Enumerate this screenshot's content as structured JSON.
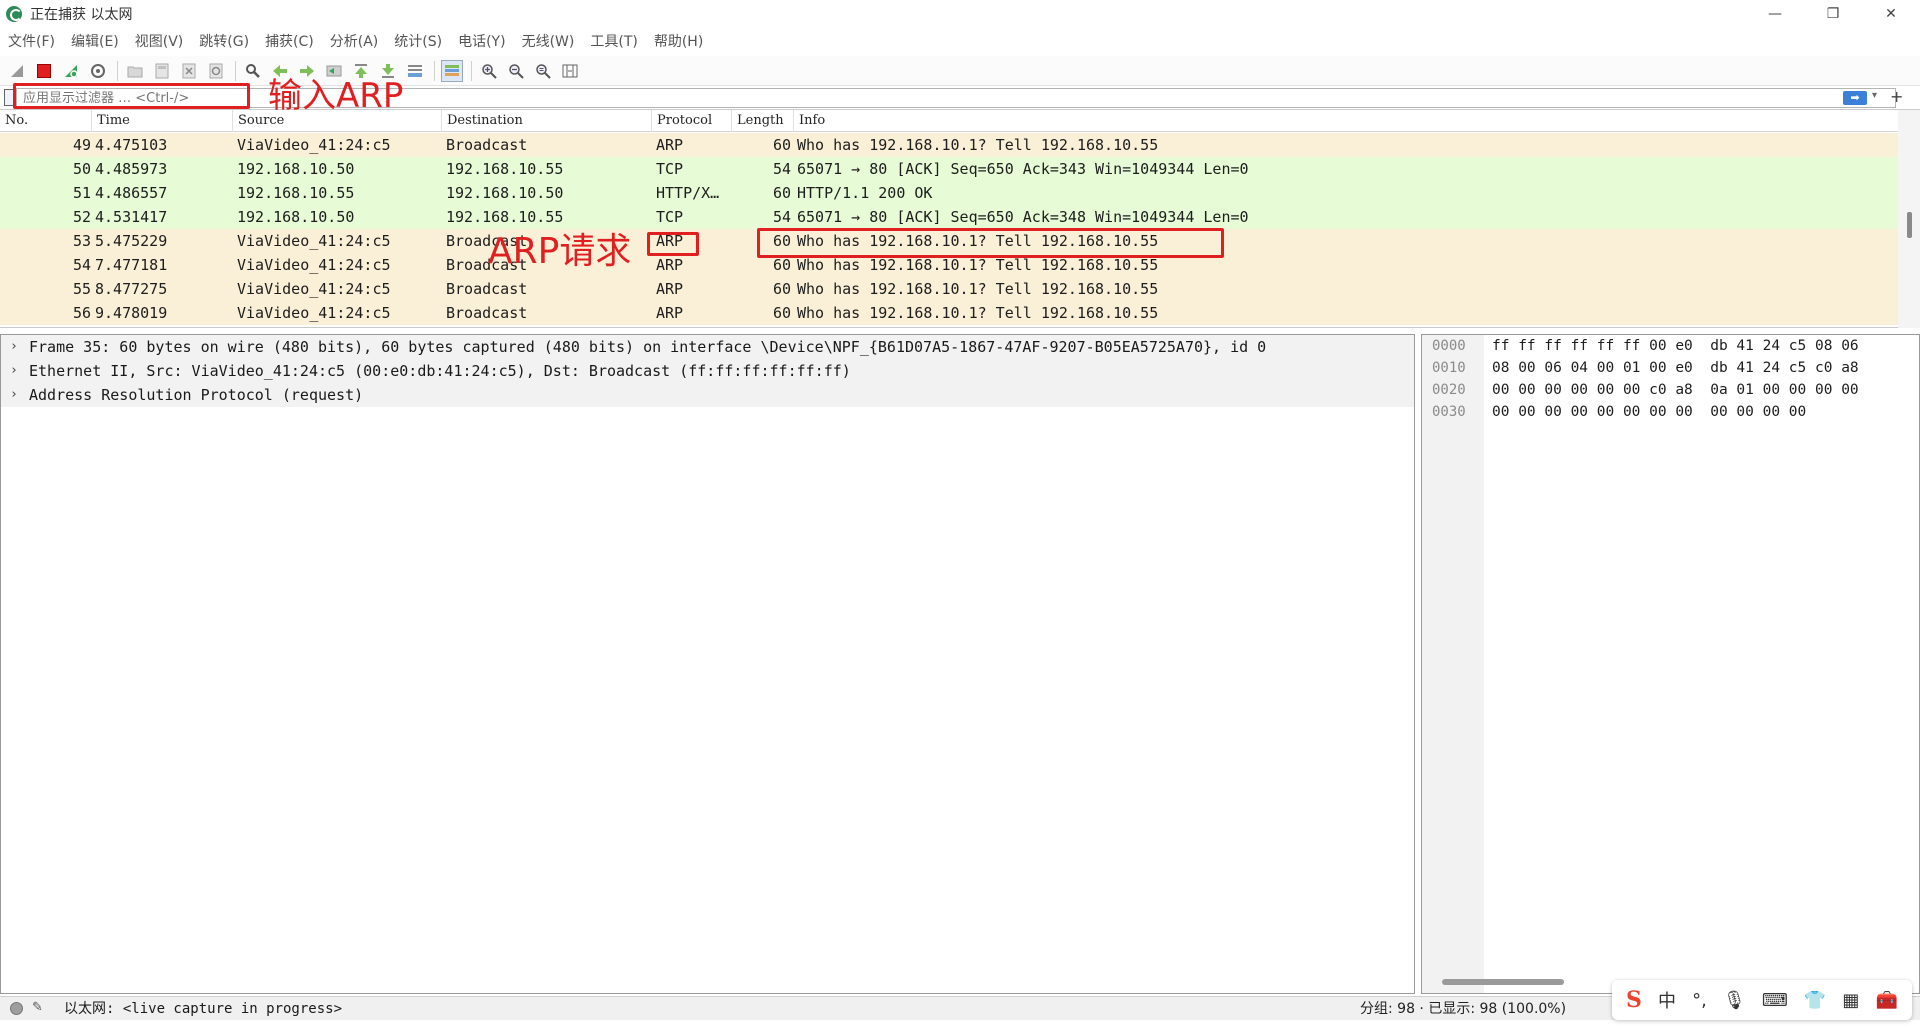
{
  "window": {
    "title": "正在捕获 以太网",
    "minimize": "—",
    "restore": "❐",
    "close": "✕"
  },
  "menu": [
    "文件(F)",
    "编辑(E)",
    "视图(V)",
    "跳转(G)",
    "捕获(C)",
    "分析(A)",
    "统计(S)",
    "电话(Y)",
    "无线(W)",
    "工具(T)",
    "帮助(H)"
  ],
  "toolbar": {
    "icons": [
      "shark-fin-icon",
      "stop-capture-icon",
      "restart-capture-icon",
      "capture-options-icon",
      "open-file-icon",
      "save-file-icon",
      "close-file-icon",
      "reload-file-icon",
      "find-packet-icon",
      "go-back-icon",
      "go-forward-icon",
      "go-to-packet-icon",
      "go-first-icon",
      "go-last-icon",
      "autoscroll-icon",
      "colorize-icon",
      "zoom-in-icon",
      "zoom-out-icon",
      "zoom-normal-icon",
      "resize-columns-icon"
    ]
  },
  "filter": {
    "placeholder": "应用显示过滤器 … <Ctrl-/>",
    "apply_glyph": "➡",
    "dropdown_glyph": "▾",
    "add_glyph": "+"
  },
  "packet_list": {
    "columns": [
      "No.",
      "Time",
      "Source",
      "Destination",
      "Protocol",
      "Length",
      "Info"
    ],
    "rows": [
      {
        "no": "49",
        "time": "4.475103",
        "source": "ViaVideo_41:24:c5",
        "destination": "Broadcast",
        "protocol": "ARP",
        "length": "60",
        "info": "Who has 192.168.10.1? Tell 192.168.10.55",
        "kind": "arp"
      },
      {
        "no": "50",
        "time": "4.485973",
        "source": "192.168.10.50",
        "destination": "192.168.10.55",
        "protocol": "TCP",
        "length": "54",
        "info": "65071 → 80 [ACK] Seq=650 Ack=343 Win=1049344 Len=0",
        "kind": "tcp"
      },
      {
        "no": "51",
        "time": "4.486557",
        "source": "192.168.10.55",
        "destination": "192.168.10.50",
        "protocol": "HTTP/X…",
        "length": "60",
        "info": "HTTP/1.1 200 OK",
        "kind": "tcp"
      },
      {
        "no": "52",
        "time": "4.531417",
        "source": "192.168.10.50",
        "destination": "192.168.10.55",
        "protocol": "TCP",
        "length": "54",
        "info": "65071 → 80 [ACK] Seq=650 Ack=348 Win=1049344 Len=0",
        "kind": "tcp"
      },
      {
        "no": "53",
        "time": "5.475229",
        "source": "ViaVideo_41:24:c5",
        "destination": "Broadcast",
        "protocol": "ARP",
        "length": "60",
        "info": "Who has 192.168.10.1? Tell 192.168.10.55",
        "kind": "arp"
      },
      {
        "no": "54",
        "time": "7.477181",
        "source": "ViaVideo_41:24:c5",
        "destination": "Broadcast",
        "protocol": "ARP",
        "length": "60",
        "info": "Who has 192.168.10.1? Tell 192.168.10.55",
        "kind": "arp"
      },
      {
        "no": "55",
        "time": "8.477275",
        "source": "ViaVideo_41:24:c5",
        "destination": "Broadcast",
        "protocol": "ARP",
        "length": "60",
        "info": "Who has 192.168.10.1? Tell 192.168.10.55",
        "kind": "arp"
      },
      {
        "no": "56",
        "time": "9.478019",
        "source": "ViaVideo_41:24:c5",
        "destination": "Broadcast",
        "protocol": "ARP",
        "length": "60",
        "info": "Who has 192.168.10.1? Tell 192.168.10.55",
        "kind": "arp"
      }
    ]
  },
  "details": [
    "Frame 35: 60 bytes on wire (480 bits), 60 bytes captured (480 bits) on interface \\Device\\NPF_{B61D07A5-1867-47AF-9207-B05EA5725A70}, id 0",
    "Ethernet II, Src: ViaVideo_41:24:c5 (00:e0:db:41:24:c5), Dst: Broadcast (ff:ff:ff:ff:ff:ff)",
    "Address Resolution Protocol (request)"
  ],
  "details_chevron": "›",
  "hex": [
    {
      "offset": "0000",
      "bytes": "ff ff ff ff ff ff 00 e0  db 41 24 c5 08 06"
    },
    {
      "offset": "0010",
      "bytes": "08 00 06 04 00 01 00 e0  db 41 24 c5 c0 a8"
    },
    {
      "offset": "0020",
      "bytes": "00 00 00 00 00 00 c0 a8  0a 01 00 00 00 00"
    },
    {
      "offset": "0030",
      "bytes": "00 00 00 00 00 00 00 00  00 00 00 00"
    }
  ],
  "status": {
    "note_glyph": "✎",
    "interface": "以太网: <live capture in progress>",
    "packets": "分组: 98 · 已显示: 98 (100.0%)"
  },
  "ime": {
    "logo": "S",
    "items": [
      "中",
      "°,",
      "🎙",
      "⌨",
      "👕",
      "▦",
      "🧰"
    ]
  },
  "annotations": {
    "filter_hint": "输入ARP",
    "arp_request": "ARP请求"
  },
  "colors": {
    "arp_row": "#faf0d7",
    "tcp_row": "#e7fbd6",
    "annotation": "#e02020"
  }
}
